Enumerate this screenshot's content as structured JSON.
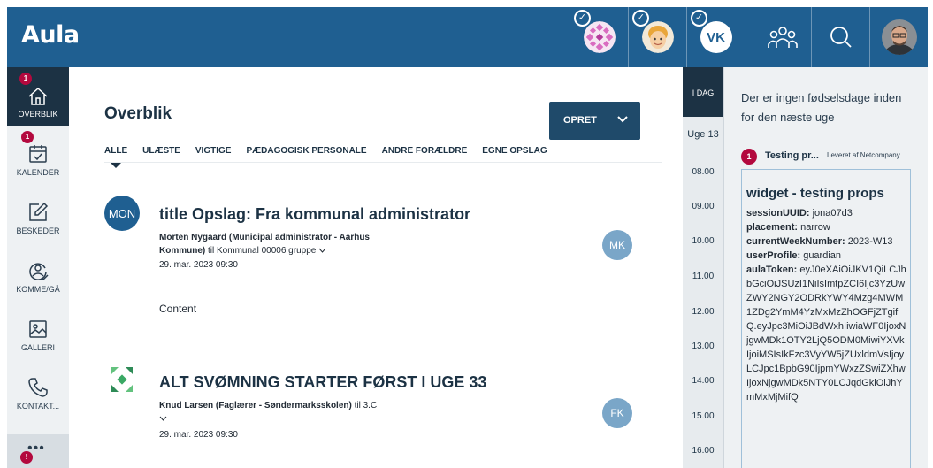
{
  "header": {
    "logo": "Aula",
    "profiles": [
      {
        "kind": "pattern-avatar",
        "checked": true
      },
      {
        "kind": "child-photo",
        "checked": true
      },
      {
        "kind": "initials",
        "initials": "VK",
        "checked": true
      }
    ]
  },
  "nav": {
    "items": [
      {
        "label": "OVERBLIK",
        "badge": "1"
      },
      {
        "label": "KALENDER",
        "badge": "1"
      },
      {
        "label": "BESKEDER"
      },
      {
        "label": "KOMME/GÅ"
      },
      {
        "label": "GALLERI"
      },
      {
        "label": "KONTAKT..."
      }
    ],
    "more_label": "•••",
    "more_badge": "!"
  },
  "main": {
    "title": "Overblik",
    "create_button": "OPRET",
    "tabs": [
      "ALLE",
      "ULÆSTE",
      "VIGTIGE",
      "PÆDAGOGISK PERSONALE",
      "ANDRE FORÆLDRE",
      "EGNE OPSLAG"
    ],
    "posts": [
      {
        "avatar_text": "MON",
        "title": "title Opslag: Fra kommunal administrator",
        "author": "Morten Nygaard (Municipal administrator - Aarhus Kommune)",
        "to": " til Kommunal 00006 gruppe",
        "date": "29. mar. 2023 09:30",
        "content": "Content",
        "initials": "MK"
      },
      {
        "title": "ALT SVØMNING STARTER FØRST I UGE 33",
        "author": "Knud Larsen (Faglærer - Søndermarksskolen)",
        "to": " til 3.C",
        "date": "29. mar. 2023 09:30",
        "initials": "FK"
      }
    ]
  },
  "calendar": {
    "today": "I DAG",
    "week": "Uge 13",
    "hours": [
      "08.00",
      "09.00",
      "10.00",
      "11.00",
      "12.00",
      "13.00",
      "14.00",
      "15.00",
      "16.00"
    ]
  },
  "side": {
    "birthdays": "Der er ingen fødselsdage inden for den næste uge",
    "widget": {
      "badge": "1",
      "name": "Testing pr...",
      "provider": "Leveret af Netcompany",
      "title": "widget - testing props",
      "props": [
        {
          "key": "sessionUUID:",
          "value": " jona07d3"
        },
        {
          "key": "placement:",
          "value": " narrow"
        },
        {
          "key": "currentWeekNumber:",
          "value": " 2023-W13"
        },
        {
          "key": "userProfile:",
          "value": " guardian"
        },
        {
          "key": "aulaToken:",
          "value": " eyJ0eXAiOiJKV1QiLCJhbGciOiJSUzI1NiIsImtpZCI6Ijc3YzUwZWY2NGY2ODRkYWY4Mzg4MWM1ZDg2YmM4YzMxMzZhOGFjZTgifQ.eyJpc3MiOiJBdWxhIiwiaWF0IjoxNjgwMDk1OTY2LjQ5ODM0MiwiYXVkIjoiMSIsIkFzc3VyYW5jZUxldmVsIjoyLCJpc1BpbG90IjpmYWxzZSwiZXhwIjoxNjgwMDk5NTY0LCJqdGkiOiJhYmMxMjMifQ"
        }
      ]
    }
  }
}
